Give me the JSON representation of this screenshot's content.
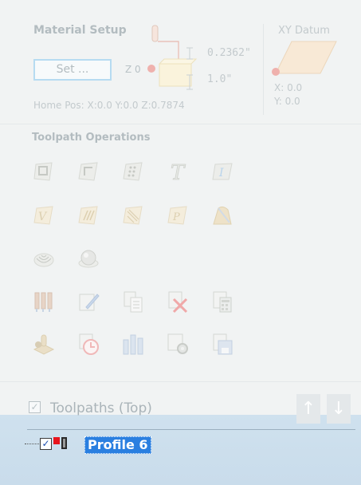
{
  "material_setup": {
    "title": "Material Setup",
    "set_button": "Set ...",
    "z_zero": "Z 0",
    "thickness_top": "0.2362\"",
    "thickness_bottom": "1.0\"",
    "home_pos": "Home Pos:  X:0.0 Y:0.0 Z:0.7874"
  },
  "xy_datum": {
    "title": "XY Datum",
    "x": "X: 0.0",
    "y": "Y: 0.0"
  },
  "toolpath_operations": {
    "title": "Toolpath Operations",
    "tools": [
      "profile-toolpath-icon",
      "pocket-toolpath-icon",
      "drilling-toolpath-icon",
      "texture-text-icon",
      "inlay-toolpath-icon",
      "v-carve-toolpath-icon",
      "fluting-toolpath-icon",
      "texture-toolpath-icon",
      "prism-toolpath-icon",
      "moulding-toolpath-icon",
      "3d-roughing-icon",
      "3d-finishing-icon",
      "drill-template-icon",
      "edit-toolpath-icon",
      "toolpath-summary-icon",
      "delete-toolpath-icon",
      "calculate-icon",
      "preview-material-icon",
      "time-estimate-icon",
      "tool-database-icon",
      "toolpath-settings-icon",
      "save-toolpath-icon"
    ]
  },
  "toolpaths": {
    "title": "Toolpaths (Top)",
    "up_arrow": "↑",
    "down_arrow": "↓",
    "items": [
      {
        "label": "Profile 6",
        "checked": true
      }
    ]
  },
  "colors": {
    "selection": "#2a7fe0",
    "panel": "#c9dceb",
    "faded_text": "#b9c2c6"
  }
}
